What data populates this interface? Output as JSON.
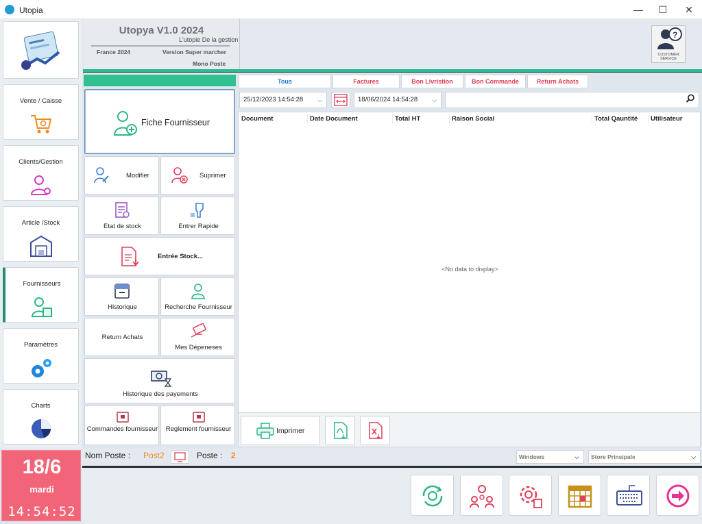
{
  "window": {
    "title": "Utopia",
    "minimize": "—",
    "maximize": "☐",
    "close": "✕"
  },
  "header": {
    "title": "Utopya V1.0 2024",
    "subtitle": "L'utopie De la gestion",
    "country": "France 2024",
    "version": "Version Super marcher",
    "mode": "Mono Poste",
    "customer_service": "CUSTOMER SERVICE"
  },
  "nav": {
    "items": [
      {
        "label": "Vente / Caisse",
        "icon": "shopping-cart-icon"
      },
      {
        "label": "Clients/Gestion",
        "icon": "client-gear-icon"
      },
      {
        "label": "Article /Stock",
        "icon": "warehouse-icon"
      },
      {
        "label": "Fournisseurs",
        "icon": "supplier-icon"
      },
      {
        "label": "Paramètres",
        "icon": "gears-icon"
      },
      {
        "label": "Charts",
        "icon": "pie-chart-icon"
      }
    ],
    "active": "Fournisseurs"
  },
  "actions": {
    "fiche": "Fiche Fournisseur",
    "modifier": "Modifier",
    "suprimer": "Suprimer",
    "etat_stock": "Etat de stock",
    "entrer_rapide": "Entrer Rapide",
    "entree_stock": "Entrée Stock...",
    "historique": "Historique",
    "recherche": "Recherche Fournisseur",
    "return_achats": "Return Achats",
    "depenses": "Mes Dépeneses",
    "historique_payements": "Historique des payements",
    "commandes": "Commandes fournisseur",
    "reglement": "Reglement fournisseur"
  },
  "tabs": [
    {
      "label": "Tous",
      "color": "#1f7fd1"
    },
    {
      "label": "Factures",
      "color": "#e0405a"
    },
    {
      "label": "Bon Livristion",
      "color": "#e0405a"
    },
    {
      "label": "Bon Commande",
      "color": "#e0405a"
    },
    {
      "label": "Return Achats",
      "color": "#e0405a"
    }
  ],
  "filters": {
    "date_from": "25/12/2023 14:54:28",
    "date_to": "18/06/2024 14:54:28",
    "search_value": ""
  },
  "table": {
    "columns": [
      "Document",
      "Date Document",
      "Total HT",
      "Raison Social",
      "Total Qauntité",
      "Utilisateur"
    ],
    "empty_text": "<No data to display>"
  },
  "grid_actions": {
    "print": "Imprimer"
  },
  "status": {
    "nom_poste_label": "Nom Poste :",
    "nom_poste_value": "Post2",
    "poste_label": "Poste :",
    "poste_value": "2",
    "theme_select": "Windows",
    "store_select": "Store Prinsipale"
  },
  "clock": {
    "date": "18/6",
    "day": "mardi",
    "time": "14:54:52"
  },
  "colors": {
    "accent_green": "#2dba93",
    "pink": "#f26579",
    "orange": "#f08a24"
  }
}
